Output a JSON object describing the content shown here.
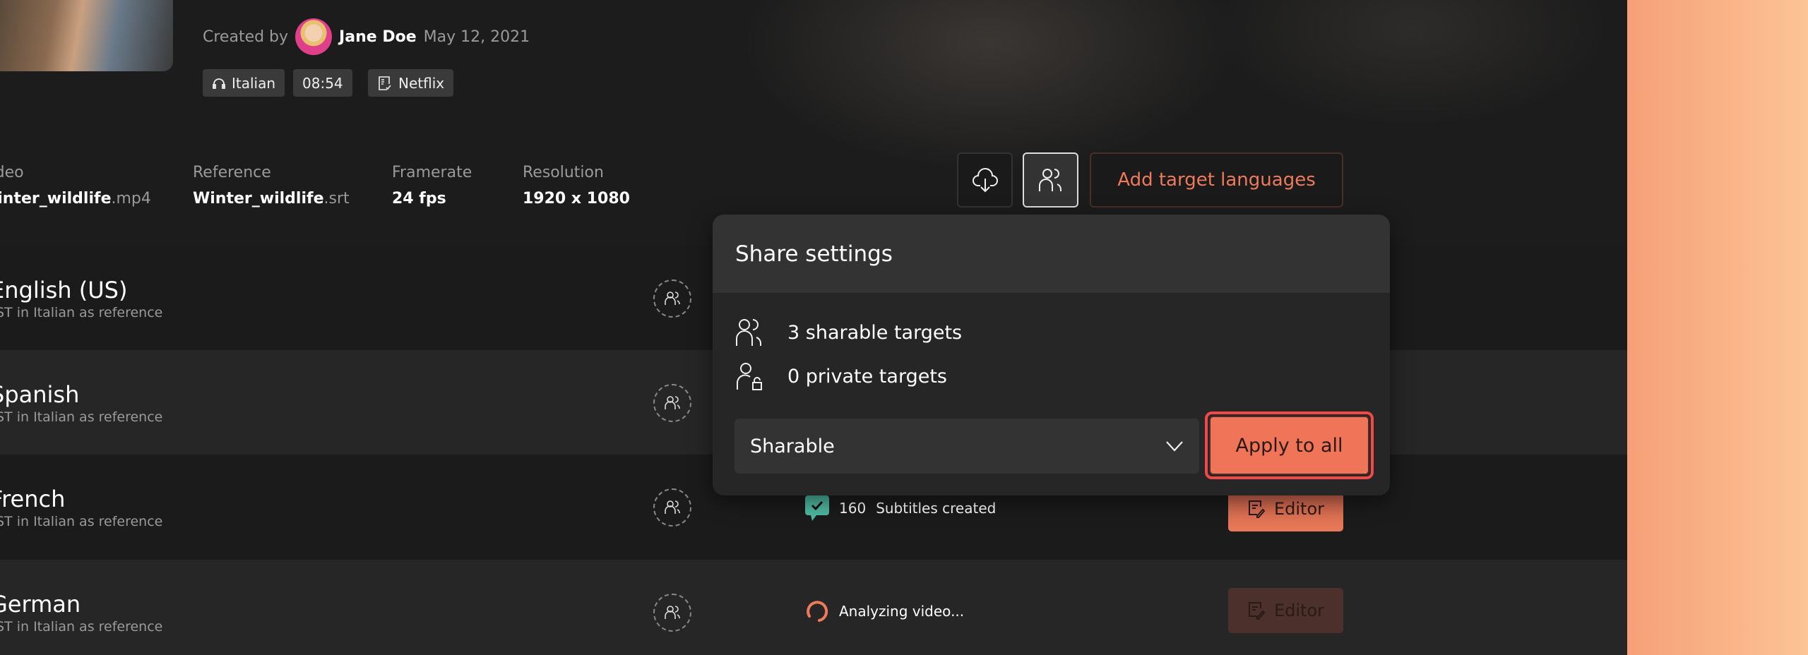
{
  "header": {
    "created_by_label": "Created by",
    "author": "Jane Doe",
    "date": "May 12, 2021",
    "tags": {
      "language": "Italian",
      "duration": "08:54",
      "guideline": "Netflix"
    }
  },
  "info": [
    {
      "label": "Video",
      "name": "Winter_wildlife",
      "ext": ".mp4"
    },
    {
      "label": "Reference",
      "name": "Winter_wildlife",
      "ext": ".srt"
    },
    {
      "label": "Framerate",
      "value": "24 fps"
    },
    {
      "label": "Resolution",
      "value": "1920 x 1080"
    }
  ],
  "toolbar": {
    "add_target_label": "Add target languages",
    "icons": [
      "cloud-download-icon",
      "users-icon"
    ]
  },
  "targets": [
    {
      "name": "English (US)",
      "sub": "ST in Italian as reference"
    },
    {
      "name": "Spanish",
      "sub": "ST in Italian as reference"
    },
    {
      "name": "French",
      "sub": "ST in Italian as reference",
      "count": "160",
      "status": "Subtitles created",
      "editor": "Editor"
    },
    {
      "name": "German",
      "sub": "ST in Italian as reference",
      "status": "Analyzing video...",
      "editor": "Editor"
    }
  ],
  "share_popover": {
    "title": "Share settings",
    "sharable": "3 sharable targets",
    "private": "0 private targets",
    "select_value": "Sharable",
    "apply_label": "Apply to all"
  },
  "colors": {
    "accent": "#f07458",
    "success": "#4fb8a0",
    "focus": "#f24848"
  }
}
